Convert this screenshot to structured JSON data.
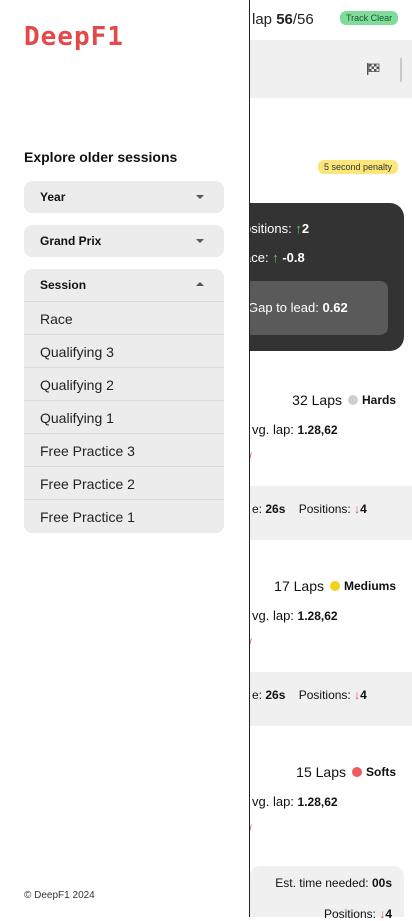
{
  "header": {
    "lap_prefix": "lap ",
    "lap_current": "56",
    "lap_total": "/56",
    "track_status": "Track Clear"
  },
  "penalty_badge": "5 second penalty",
  "summary_card": {
    "positions_label": "ositions: ",
    "positions_arrow": "↑",
    "positions_value": "2",
    "pace_label": "ace: ",
    "pace_arrow": "↑",
    "pace_value": "-0.8",
    "gap_label": "Gap to lead: ",
    "gap_value": "0.62"
  },
  "stints": [
    {
      "laps": "32 Laps",
      "tyre": "Hards",
      "tyre_color": "#cfcfcf",
      "avg_label": "vg. lap: ",
      "avg_value": "1.28,62",
      "stat_time_label": "e: ",
      "stat_time_value": "26s",
      "stat_pos_label": "Positions: ",
      "stat_pos_arrow": "↓",
      "stat_pos_value": "4"
    },
    {
      "laps": "17 Laps",
      "tyre": "Mediums",
      "tyre_color": "#f3d21b",
      "avg_label": "vg. lap: ",
      "avg_value": "1.28,62",
      "stat_time_label": "e: ",
      "stat_time_value": "26s",
      "stat_pos_label": "Positions: ",
      "stat_pos_arrow": "↓",
      "stat_pos_value": "4"
    },
    {
      "laps": "15 Laps",
      "tyre": "Softs",
      "tyre_color": "#f05a5a",
      "avg_label": "vg. lap: ",
      "avg_value": "1.28,62"
    }
  ],
  "estimate": {
    "time_label": "Est. time needed: ",
    "time_value": "00s",
    "pos_label": "Positions: ",
    "pos_arrow": "↓",
    "pos_value": "4"
  },
  "drawer": {
    "logo_text": "DeepF1",
    "explore_title": "Explore older sessions",
    "year_label": "Year",
    "grand_prix_label": "Grand Prix",
    "session_label": "Session",
    "session_options": [
      "Race",
      "Qualifying 3",
      "Qualifying 2",
      "Qualifying 1",
      "Free Practice 3",
      "Free Practice 2",
      "Free Practice 1"
    ],
    "copyright": "© DeepF1 2024"
  },
  "colors": {
    "brand_red": "#e54848",
    "track_clear_bg": "#7fdc9a",
    "penalty_bg": "#fbe67a",
    "card_dark": "#333333",
    "up_green": "#4cd36a",
    "down_red": "#e34b4b"
  }
}
